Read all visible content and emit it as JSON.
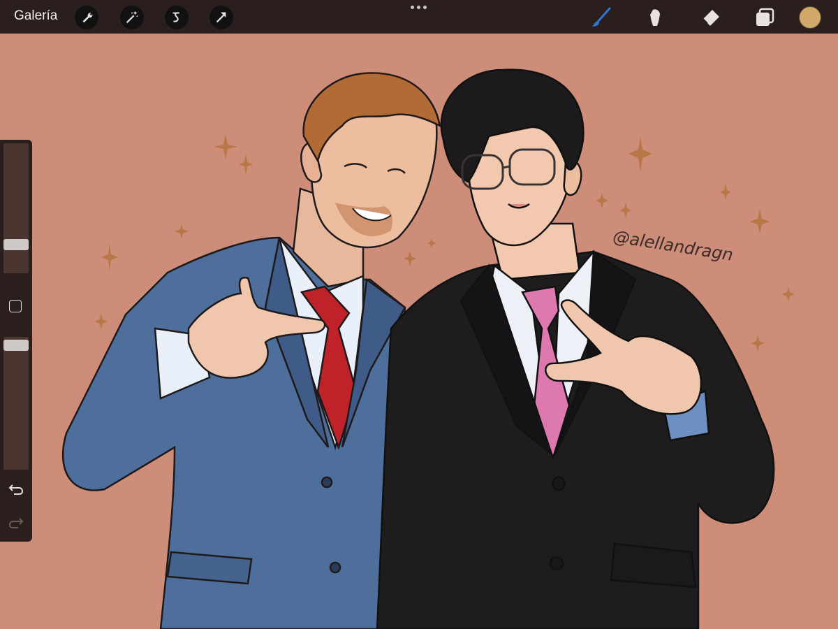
{
  "topbar": {
    "gallery_label": "Galería",
    "left_tools": [
      "wrench-icon",
      "magic-wand-icon",
      "selection-icon",
      "move-arrow-icon"
    ],
    "right_tools": [
      "brush-icon",
      "smudge-icon",
      "eraser-icon",
      "layers-icon"
    ],
    "active_tool": "brush",
    "current_color": "#d2a86a"
  },
  "sidebar": {
    "brush_size": 0.7,
    "brush_opacity": 0.95,
    "tools": [
      "modify-button",
      "undo-icon",
      "redo-icon"
    ]
  },
  "artwork": {
    "watermark": "@alellandragn",
    "background_color": "#ce8d79"
  },
  "colors": {
    "accent_brush": "#2f76d6",
    "toolbar_bg": "#2a1f1c"
  }
}
